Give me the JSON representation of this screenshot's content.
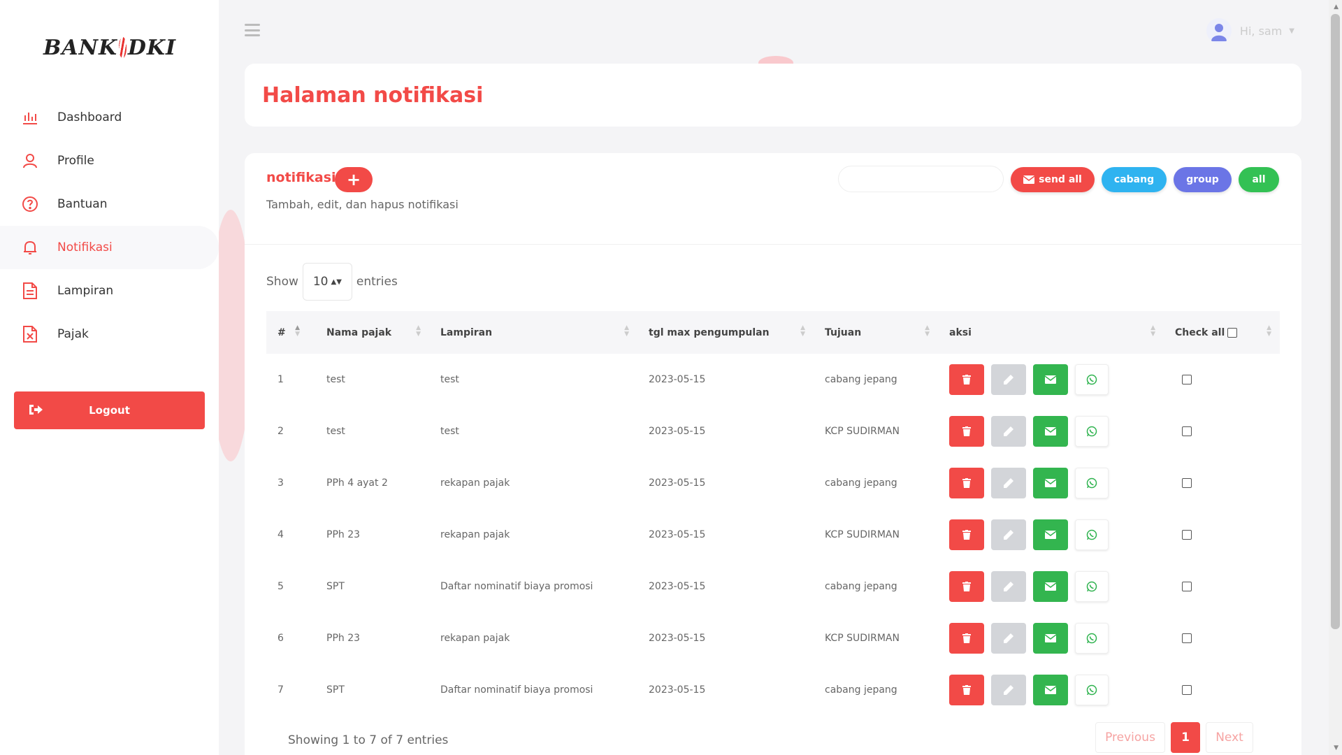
{
  "brand": {
    "name_left": "BANK",
    "name_right": "DKI",
    "accent": "#f24a47"
  },
  "sidebar": {
    "items": [
      {
        "label": "Dashboard",
        "icon": "bar-chart-icon"
      },
      {
        "label": "Profile",
        "icon": "user-icon"
      },
      {
        "label": "Bantuan",
        "icon": "help-icon"
      },
      {
        "label": "Notifikasi",
        "icon": "bell-icon",
        "active": true
      },
      {
        "label": "Lampiran",
        "icon": "file-icon"
      },
      {
        "label": "Pajak",
        "icon": "excel-file-icon"
      }
    ],
    "logout_label": "Logout"
  },
  "header": {
    "greeting": "Hi, sam"
  },
  "page": {
    "title": "Halaman notifikasi"
  },
  "card": {
    "title": "notifikasi",
    "add_label": "+",
    "subtitle": "Tambah, edit, dan hapus notifikasi",
    "search_value": "",
    "buttons": {
      "send_all": "send all",
      "cabang": "cabang",
      "group": "group",
      "all": "all"
    }
  },
  "table_controls": {
    "show_label": "Show",
    "entries_value": "10",
    "entries_label": "entries"
  },
  "table": {
    "columns": [
      "#",
      "Nama pajak",
      "Lampiran",
      "tgl max pengumpulan",
      "Tujuan",
      "aksi",
      "Check all"
    ],
    "rows": [
      {
        "no": "1",
        "nama": "test",
        "lampiran": "test",
        "tgl": "2023-05-15",
        "tujuan": "cabang jepang"
      },
      {
        "no": "2",
        "nama": "test",
        "lampiran": "test",
        "tgl": "2023-05-15",
        "tujuan": "KCP SUDIRMAN"
      },
      {
        "no": "3",
        "nama": "PPh 4 ayat 2",
        "lampiran": "rekapan pajak",
        "tgl": "2023-05-15",
        "tujuan": "cabang jepang"
      },
      {
        "no": "4",
        "nama": "PPh 23",
        "lampiran": "rekapan pajak",
        "tgl": "2023-05-15",
        "tujuan": "KCP SUDIRMAN"
      },
      {
        "no": "5",
        "nama": "SPT",
        "lampiran": "Daftar nominatif biaya promosi",
        "tgl": "2023-05-15",
        "tujuan": "cabang jepang"
      },
      {
        "no": "6",
        "nama": "PPh 23",
        "lampiran": "rekapan pajak",
        "tgl": "2023-05-15",
        "tujuan": "KCP SUDIRMAN"
      },
      {
        "no": "7",
        "nama": "SPT",
        "lampiran": "Daftar nominatif biaya promosi",
        "tgl": "2023-05-15",
        "tujuan": "cabang jepang"
      }
    ]
  },
  "footer": {
    "info": "Showing 1 to 7 of 7 entries"
  },
  "pagination": {
    "previous": "Previous",
    "current": "1",
    "next": "Next"
  }
}
